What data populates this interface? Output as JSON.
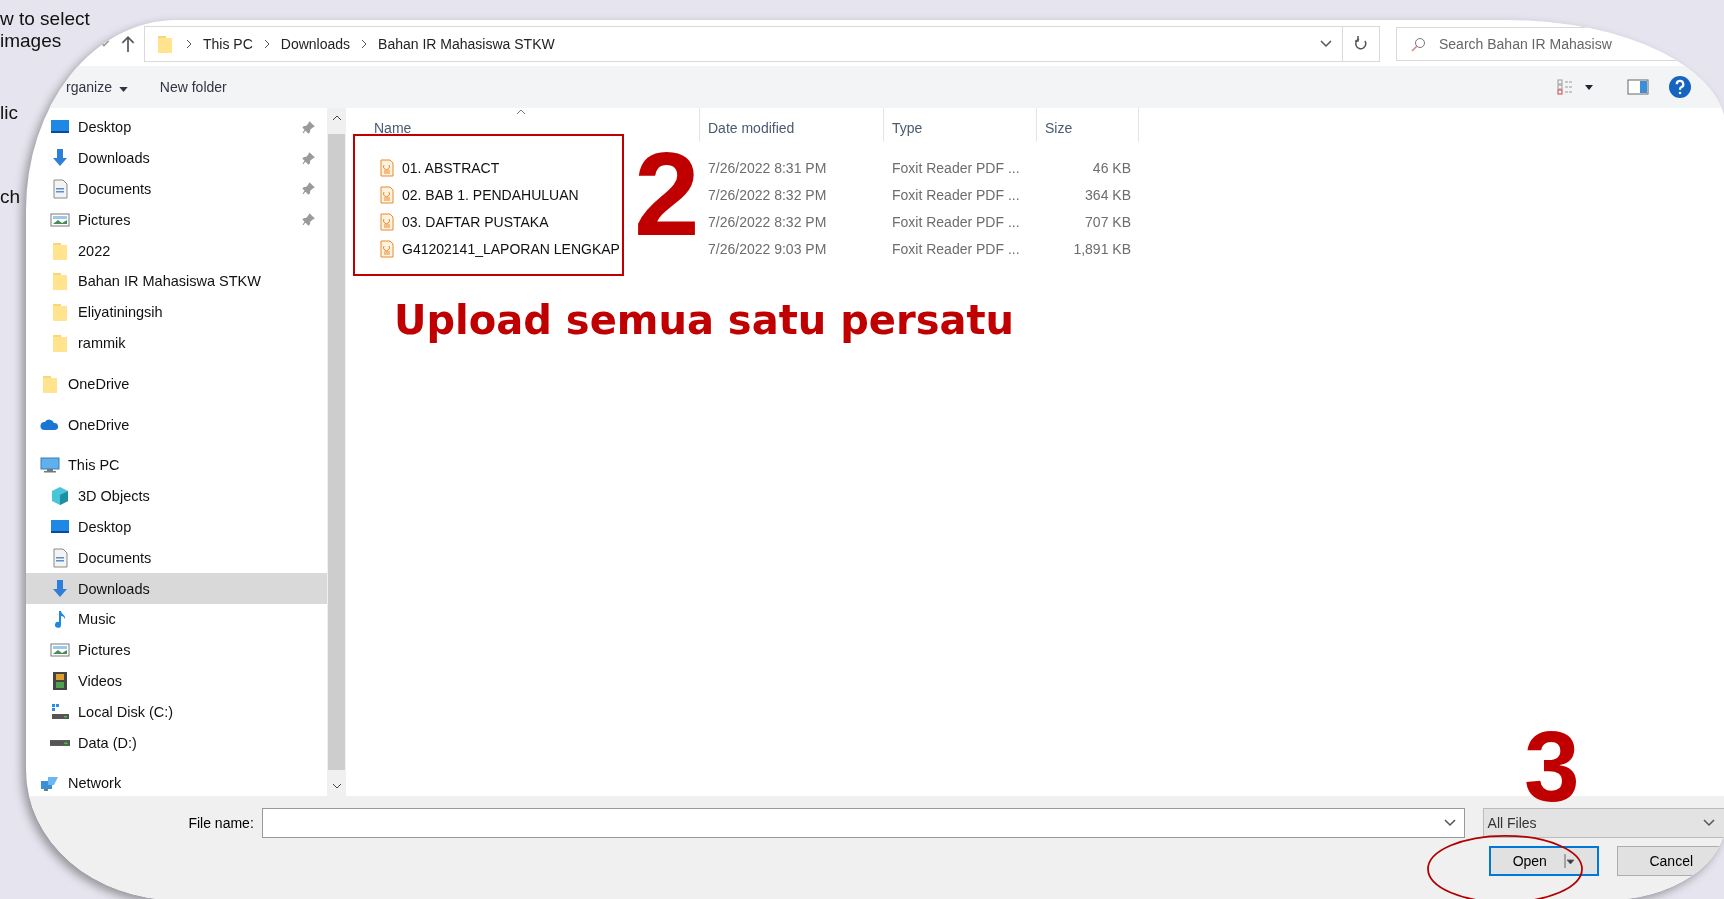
{
  "background_texts": [
    "w to select",
    "images",
    "lic",
    "ch"
  ],
  "address_bar": {
    "path": [
      "This PC",
      "Downloads",
      "Bahan IR Mahasiswa STKW"
    ]
  },
  "search": {
    "placeholder": "Search Bahan IR Mahasisw"
  },
  "toolbar": {
    "organize": "rganize",
    "new_folder": "New folder"
  },
  "sidebar": {
    "quick_access": [
      {
        "label": "Desktop",
        "kind": "desktop",
        "pinned": true,
        "selected": false
      },
      {
        "label": "Downloads",
        "kind": "downloads",
        "pinned": true,
        "selected": false
      },
      {
        "label": "Documents",
        "kind": "documents",
        "pinned": true,
        "selected": false
      },
      {
        "label": "Pictures",
        "kind": "pictures",
        "pinned": true,
        "selected": false
      },
      {
        "label": "2022",
        "kind": "folder",
        "pinned": false,
        "selected": false
      },
      {
        "label": "Bahan IR Mahasiswa STKW",
        "kind": "folder",
        "pinned": false,
        "selected": false
      },
      {
        "label": "Eliyatiningsih",
        "kind": "folder",
        "pinned": false,
        "selected": false
      },
      {
        "label": "rammik",
        "kind": "folder",
        "pinned": false,
        "selected": false
      }
    ],
    "items": [
      {
        "label": "OneDrive",
        "kind": "folder",
        "selected": false
      },
      {
        "label": "OneDrive",
        "kind": "cloud",
        "selected": false
      },
      {
        "label": "This PC",
        "kind": "pc",
        "selected": false,
        "children": [
          {
            "label": "3D Objects",
            "kind": "cube",
            "selected": false
          },
          {
            "label": "Desktop",
            "kind": "desktop",
            "selected": false
          },
          {
            "label": "Documents",
            "kind": "documents",
            "selected": false
          },
          {
            "label": "Downloads",
            "kind": "downloads",
            "selected": true
          },
          {
            "label": "Music",
            "kind": "music",
            "selected": false
          },
          {
            "label": "Pictures",
            "kind": "pictures",
            "selected": false
          },
          {
            "label": "Videos",
            "kind": "videos",
            "selected": false
          },
          {
            "label": "Local Disk (C:)",
            "kind": "system-disk",
            "selected": false
          },
          {
            "label": "Data (D:)",
            "kind": "disk",
            "selected": false
          }
        ]
      },
      {
        "label": "Network",
        "kind": "network",
        "selected": false
      }
    ]
  },
  "columns": [
    {
      "label": "Name",
      "sorted": true
    },
    {
      "label": "Date modified",
      "sorted": false
    },
    {
      "label": "Type",
      "sorted": false
    },
    {
      "label": "Size",
      "sorted": false
    }
  ],
  "files": [
    {
      "name": "01. ABSTRACT",
      "date": "7/26/2022 8:31 PM",
      "type": "Foxit Reader PDF ...",
      "size": "46 KB"
    },
    {
      "name": "02. BAB 1. PENDAHULUAN",
      "date": "7/26/2022 8:32 PM",
      "type": "Foxit Reader PDF ...",
      "size": "364 KB"
    },
    {
      "name": "03. DAFTAR PUSTAKA",
      "date": "7/26/2022 8:32 PM",
      "type": "Foxit Reader PDF ...",
      "size": "707 KB"
    },
    {
      "name": "G41202141_LAPORAN LENGKAP",
      "date": "7/26/2022 9:03 PM",
      "type": "Foxit Reader PDF ...",
      "size": "1,891 KB"
    }
  ],
  "file_name": {
    "label": "File name:"
  },
  "file_type": {
    "value": "All Files"
  },
  "buttons": [
    {
      "label": "Open",
      "default": true
    },
    {
      "label": "Cancel",
      "default": false
    }
  ],
  "annotations": {
    "step_2": "2",
    "instruction": "Upload semua satu persatu",
    "step_3": "3"
  }
}
